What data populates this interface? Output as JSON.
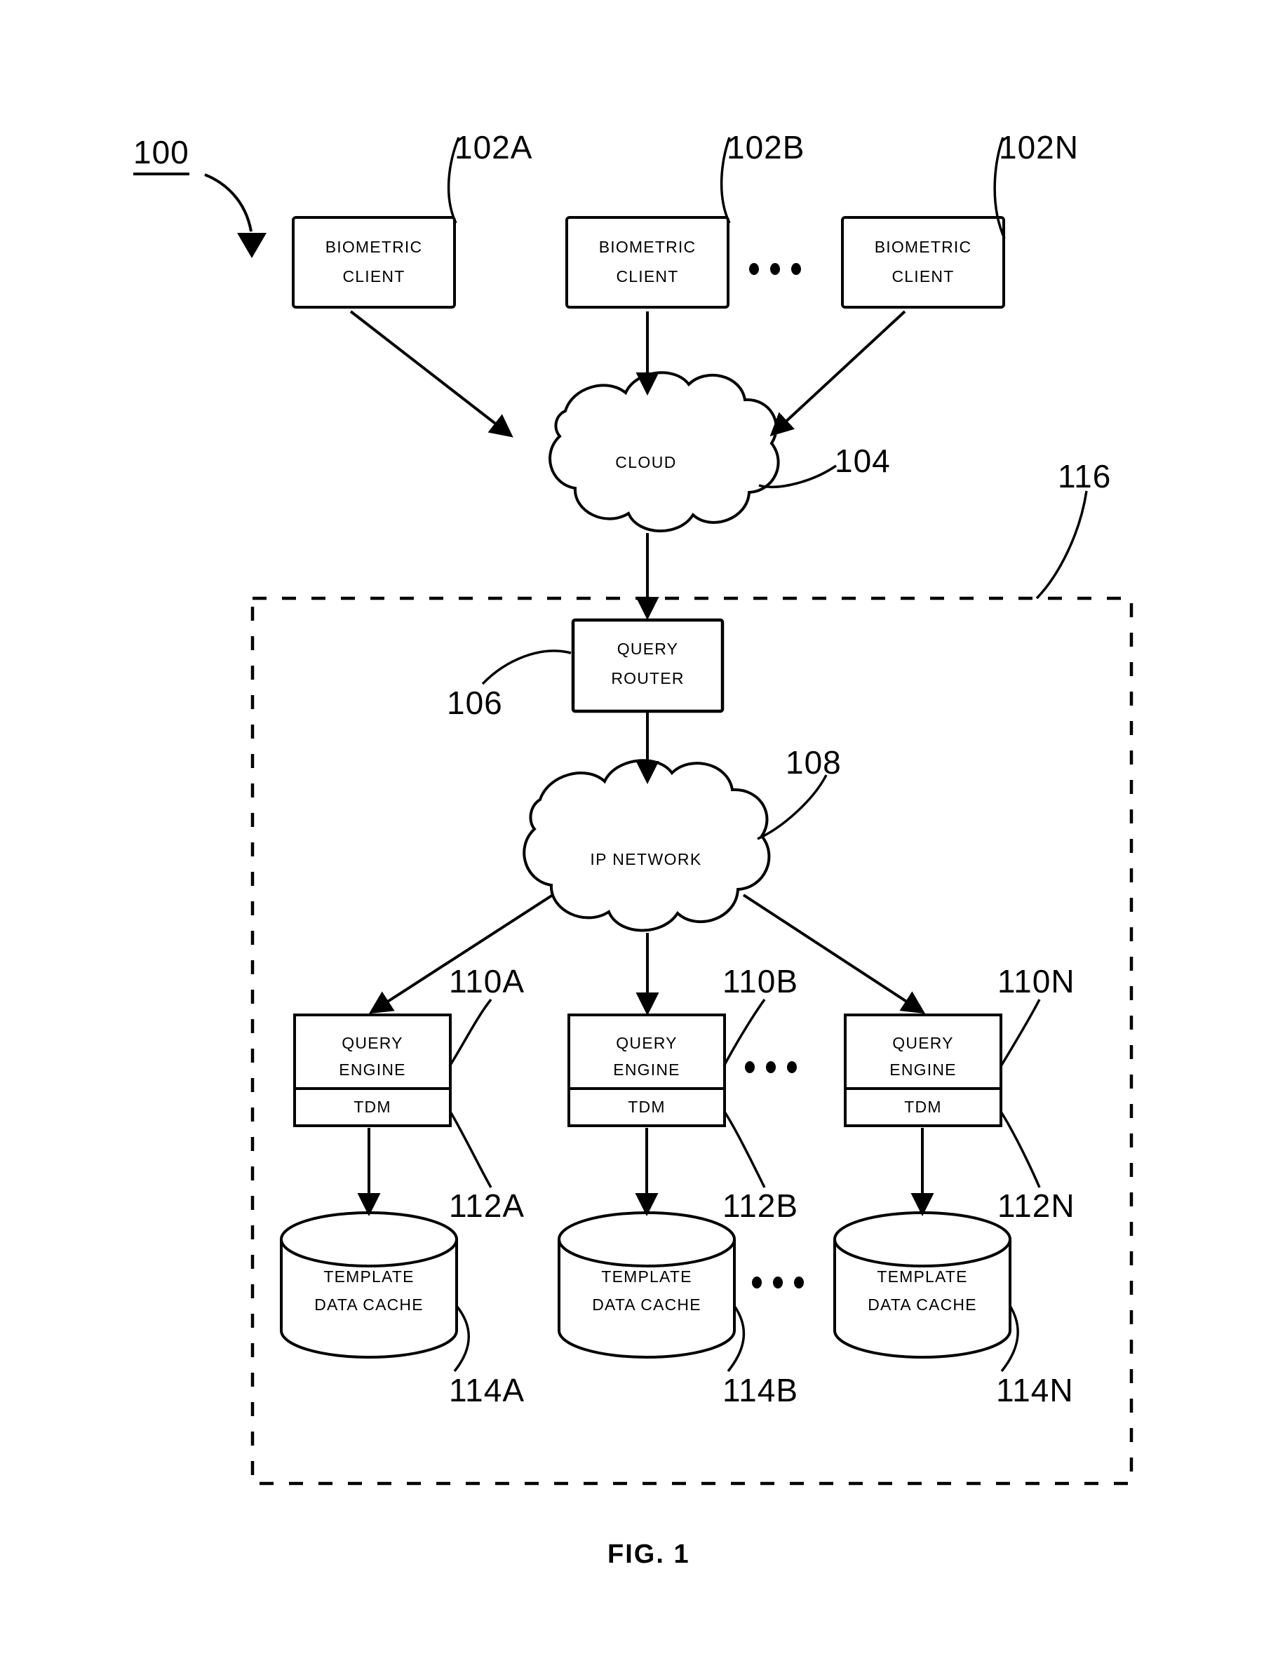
{
  "figure": {
    "caption": "FIG. 1",
    "system_ref": "100"
  },
  "nodes": {
    "biometric_clients": [
      {
        "ref": "102A",
        "line1": "BIOMETRIC",
        "line2": "CLIENT"
      },
      {
        "ref": "102B",
        "line1": "BIOMETRIC",
        "line2": "CLIENT"
      },
      {
        "ref": "102N",
        "line1": "BIOMETRIC",
        "line2": "CLIENT"
      }
    ],
    "cloud": {
      "ref": "104",
      "label": "CLOUD"
    },
    "query_router": {
      "ref": "106",
      "line1": "QUERY",
      "line2": "ROUTER"
    },
    "ip_network": {
      "ref": "108",
      "label": "IP NETWORK"
    },
    "query_engines": [
      {
        "ref": "110A",
        "line1": "QUERY",
        "line2": "ENGINE",
        "sub_ref": "112A",
        "sub_label": "TDM"
      },
      {
        "ref": "110B",
        "line1": "QUERY",
        "line2": "ENGINE",
        "sub_ref": "112B",
        "sub_label": "TDM"
      },
      {
        "ref": "110N",
        "line1": "QUERY",
        "line2": "ENGINE",
        "sub_ref": "112N",
        "sub_label": "TDM"
      }
    ],
    "template_caches": [
      {
        "ref": "114A",
        "line1": "TEMPLATE",
        "line2": "DATA CACHE"
      },
      {
        "ref": "114B",
        "line1": "TEMPLATE",
        "line2": "DATA CACHE"
      },
      {
        "ref": "114N",
        "line1": "TEMPLATE",
        "line2": "DATA CACHE"
      }
    ],
    "boundary": {
      "ref": "116"
    }
  },
  "ellipsis": {
    "clients": "• • •",
    "engines": "• • •",
    "caches": "• • •"
  },
  "colors": {
    "stroke": "#000000",
    "background": "#ffffff"
  }
}
